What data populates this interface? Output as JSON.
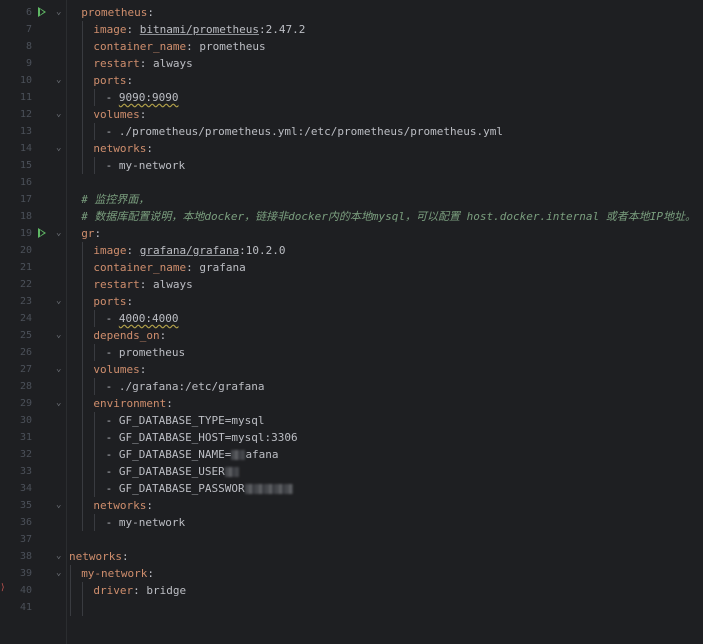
{
  "editor": {
    "lines": [
      {
        "n": "6",
        "run": true,
        "fold": true,
        "indent": 1,
        "segs": [
          {
            "t": "prometheus",
            "c": "k"
          },
          {
            "t": ":",
            "c": "v"
          }
        ]
      },
      {
        "n": "7",
        "indent": 2,
        "segs": [
          {
            "t": "image",
            "c": "k"
          },
          {
            "t": ": ",
            "c": "v"
          },
          {
            "t": "bitnami/prometheus",
            "c": "v",
            "u": true
          },
          {
            "t": ":2.47.2",
            "c": "v"
          }
        ]
      },
      {
        "n": "8",
        "indent": 2,
        "segs": [
          {
            "t": "container_name",
            "c": "k"
          },
          {
            "t": ": prometheus",
            "c": "v"
          }
        ]
      },
      {
        "n": "9",
        "indent": 2,
        "segs": [
          {
            "t": "restart",
            "c": "k"
          },
          {
            "t": ": always",
            "c": "v"
          }
        ]
      },
      {
        "n": "10",
        "fold": true,
        "indent": 2,
        "segs": [
          {
            "t": "ports",
            "c": "k"
          },
          {
            "t": ":",
            "c": "v"
          }
        ]
      },
      {
        "n": "11",
        "indent": 3,
        "segs": [
          {
            "t": "- ",
            "c": "v"
          },
          {
            "t": "9090:9090",
            "c": "v",
            "w": true
          }
        ]
      },
      {
        "n": "12",
        "fold": true,
        "indent": 2,
        "segs": [
          {
            "t": "volumes",
            "c": "k"
          },
          {
            "t": ":",
            "c": "v"
          }
        ]
      },
      {
        "n": "13",
        "indent": 3,
        "segs": [
          {
            "t": "- ./prometheus/prometheus.yml:/etc/prometheus/prometheus.yml",
            "c": "v"
          }
        ]
      },
      {
        "n": "14",
        "fold": true,
        "indent": 2,
        "segs": [
          {
            "t": "networks",
            "c": "k"
          },
          {
            "t": ":",
            "c": "v"
          }
        ]
      },
      {
        "n": "15",
        "indent": 3,
        "segs": [
          {
            "t": "- my-network",
            "c": "v"
          }
        ]
      },
      {
        "n": "16",
        "indent": 0,
        "segs": []
      },
      {
        "n": "17",
        "indent": 1,
        "segs": [
          {
            "t": "# 监控界面，",
            "c": "c"
          }
        ]
      },
      {
        "n": "18",
        "indent": 1,
        "segs": [
          {
            "t": "# 数据库配置说明，本地docker，链接非docker内的本地mysql，可以配置 host.docker.internal 或者本地IP地址。",
            "c": "c"
          }
        ]
      },
      {
        "n": "19",
        "run": true,
        "fold": true,
        "indent": 1,
        "segs": [
          {
            "t": "gr",
            "c": "k"
          },
          {
            "t": ":",
            "c": "v"
          }
        ]
      },
      {
        "n": "20",
        "indent": 2,
        "segs": [
          {
            "t": "image",
            "c": "k"
          },
          {
            "t": ": ",
            "c": "v"
          },
          {
            "t": "grafana/grafana",
            "c": "v",
            "u": true
          },
          {
            "t": ":10.2.0",
            "c": "v"
          }
        ]
      },
      {
        "n": "21",
        "indent": 2,
        "segs": [
          {
            "t": "container_name",
            "c": "k"
          },
          {
            "t": ": grafana",
            "c": "v"
          }
        ]
      },
      {
        "n": "22",
        "indent": 2,
        "segs": [
          {
            "t": "restart",
            "c": "k"
          },
          {
            "t": ": always",
            "c": "v"
          }
        ]
      },
      {
        "n": "23",
        "fold": true,
        "indent": 2,
        "segs": [
          {
            "t": "ports",
            "c": "k"
          },
          {
            "t": ":",
            "c": "v"
          }
        ]
      },
      {
        "n": "24",
        "indent": 3,
        "segs": [
          {
            "t": "- ",
            "c": "v"
          },
          {
            "t": "4000:4000",
            "c": "v",
            "w": true
          }
        ]
      },
      {
        "n": "25",
        "fold": true,
        "indent": 2,
        "segs": [
          {
            "t": "depends_on",
            "c": "k"
          },
          {
            "t": ":",
            "c": "v"
          }
        ]
      },
      {
        "n": "26",
        "indent": 3,
        "segs": [
          {
            "t": "- prometheus",
            "c": "v"
          }
        ]
      },
      {
        "n": "27",
        "fold": true,
        "indent": 2,
        "segs": [
          {
            "t": "volumes",
            "c": "k"
          },
          {
            "t": ":",
            "c": "v"
          }
        ]
      },
      {
        "n": "28",
        "indent": 3,
        "segs": [
          {
            "t": "- ./grafana:/etc/grafana",
            "c": "v"
          }
        ]
      },
      {
        "n": "29",
        "fold": true,
        "indent": 2,
        "segs": [
          {
            "t": "environment",
            "c": "k"
          },
          {
            "t": ":",
            "c": "v"
          }
        ]
      },
      {
        "n": "30",
        "indent": 3,
        "segs": [
          {
            "t": "- GF_DATABASE_TYPE=mysql",
            "c": "v"
          }
        ]
      },
      {
        "n": "31",
        "indent": 3,
        "segs": [
          {
            "t": "- GF_DATABASE_HOST=mysql:3306",
            "c": "v"
          }
        ]
      },
      {
        "n": "32",
        "indent": 3,
        "segs": [
          {
            "t": "- GF_DATABASE_NAME=",
            "c": "v"
          },
          {
            "blur": "short"
          },
          {
            "t": "afana",
            "c": "v"
          }
        ]
      },
      {
        "n": "33",
        "indent": 3,
        "segs": [
          {
            "t": "- GF_DATABASE_USER",
            "c": "v"
          },
          {
            "blur": "short"
          }
        ]
      },
      {
        "n": "34",
        "indent": 3,
        "segs": [
          {
            "t": "- GF_DATABASE_PASSWOR",
            "c": "v"
          },
          {
            "blur": "mid"
          }
        ]
      },
      {
        "n": "35",
        "fold": true,
        "indent": 2,
        "segs": [
          {
            "t": "networks",
            "c": "k"
          },
          {
            "t": ":",
            "c": "v"
          }
        ]
      },
      {
        "n": "36",
        "indent": 3,
        "segs": [
          {
            "t": "- my-network",
            "c": "v"
          }
        ]
      },
      {
        "n": "37",
        "indent": 0,
        "segs": []
      },
      {
        "n": "38",
        "fold": true,
        "indent": 0,
        "segs": [
          {
            "t": "networks",
            "c": "k"
          },
          {
            "t": ":",
            "c": "v"
          }
        ]
      },
      {
        "n": "39",
        "fold": true,
        "indent": 1,
        "segs": [
          {
            "t": "my-network",
            "c": "k"
          },
          {
            "t": ":",
            "c": "v"
          }
        ]
      },
      {
        "n": "40",
        "indent": 2,
        "segs": [
          {
            "t": "driver",
            "c": "k"
          },
          {
            "t": ": bridge",
            "c": "v"
          }
        ]
      },
      {
        "n": "41",
        "indent": 0,
        "segs": []
      }
    ]
  },
  "icons": {
    "run": "run-gutter-icon",
    "fold": "fold-chevron-icon"
  },
  "colors": {
    "background": "#1e1f22",
    "key": "#cf8e6d",
    "value": "#bcbec4",
    "comment": "#7a9e7e",
    "line_number": "#4b5059",
    "run_icon": "#5fb865"
  }
}
